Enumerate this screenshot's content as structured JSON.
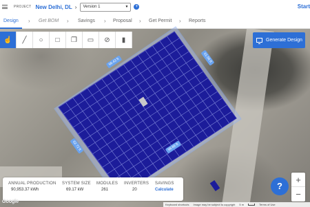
{
  "header": {
    "project_label": "PROJECT",
    "project_name": "New Delhi, DL",
    "version": "Version 1",
    "start_label": "Start"
  },
  "tabs": [
    {
      "label": "Design",
      "state": "active"
    },
    {
      "label": "Get BOM",
      "state": "disabled"
    },
    {
      "label": "Savings",
      "state": "normal"
    },
    {
      "label": "Proposal",
      "state": "normal"
    },
    {
      "label": "Get Permit",
      "state": "normal"
    },
    {
      "label": "Reports",
      "state": "normal"
    }
  ],
  "toolbar": {
    "tools": [
      {
        "icon": "hand-pointer-icon",
        "active": true
      },
      {
        "icon": "line-icon",
        "active": false
      },
      {
        "icon": "circle-icon",
        "active": false
      },
      {
        "icon": "rectangle-icon",
        "active": false
      },
      {
        "icon": "copy-icon",
        "active": false
      },
      {
        "icon": "clipboard-icon",
        "active": false
      },
      {
        "icon": "eye-slash-icon",
        "active": false
      },
      {
        "icon": "trash-icon",
        "active": false
      }
    ]
  },
  "generate_button": {
    "label": "Generate Design"
  },
  "dimensions": {
    "top": "96.43 ft",
    "right": "61.58 ft",
    "left": "62.72 ft",
    "bottom": "96.66 ft"
  },
  "stats": {
    "annual_production": {
      "label": "ANNUAL PRODUCTION",
      "value": "90,953.37 kWh"
    },
    "system_size": {
      "label": "SYSTEM SIZE",
      "value": "69.17 kW"
    },
    "modules": {
      "label": "MODULES",
      "value": "261"
    },
    "inverters": {
      "label": "INVERTERS",
      "value": "20"
    },
    "savings": {
      "label": "SAVINGS",
      "value": "Calculate"
    }
  },
  "help_label": "?",
  "zoom": {
    "in": "+",
    "out": "−"
  },
  "map_footer": {
    "logo": "Google",
    "shortcuts": "Keyboard shortcuts",
    "copyright": "Image may be subject to copyright",
    "scale": "5 m",
    "terms": "Terms of Use"
  },
  "colors": {
    "accent": "#2d6fd6",
    "panel": "#1c1c9a",
    "panel_grid": "#7f86d9",
    "roof_outline": "#8fb0ee"
  }
}
